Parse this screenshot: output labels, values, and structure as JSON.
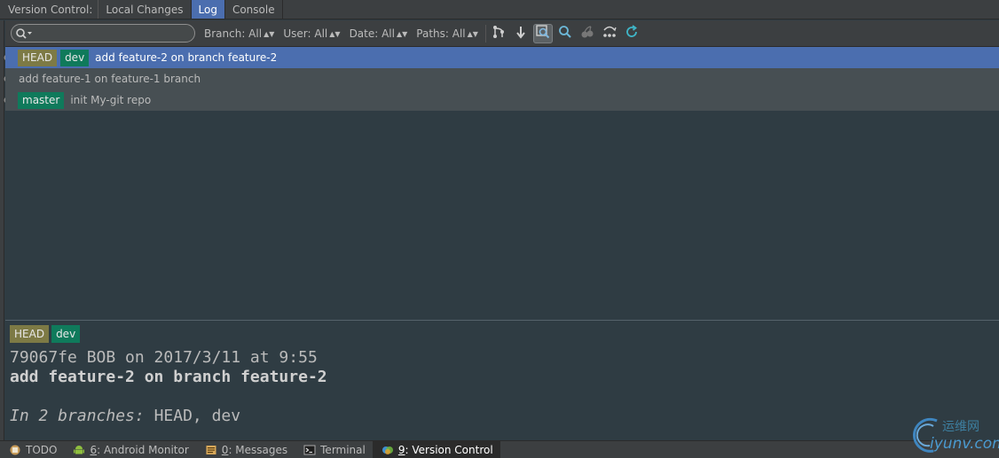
{
  "tabbar": {
    "label": "Version Control:",
    "tabs": [
      {
        "label": "Local Changes",
        "active": false
      },
      {
        "label": "Log",
        "active": true
      },
      {
        "label": "Console",
        "active": false
      }
    ]
  },
  "toolbar": {
    "search_value": "",
    "filters": {
      "branch": "Branch: All",
      "user": "User: All",
      "date": "Date: All",
      "paths": "Paths: All"
    },
    "buttons": [
      "branches-graph-icon",
      "go-to-head-icon",
      "highlight-icon",
      "find-icon",
      "cherry-pick-icon",
      "intellisort-icon",
      "refresh-icon"
    ]
  },
  "log": {
    "rows": [
      {
        "refs": [
          "HEAD",
          "dev"
        ],
        "message": "add feature-2 on branch feature-2",
        "selected": true
      },
      {
        "refs": [],
        "message": "add feature-1 on feature-1 branch",
        "selected": false
      },
      {
        "refs": [
          "master"
        ],
        "message": "init My-git repo",
        "selected": false
      }
    ]
  },
  "details": {
    "refs": [
      "HEAD",
      "dev"
    ],
    "meta": "79067fe BOB on 2017/3/11 at 9:55",
    "subject": "add feature-2 on branch feature-2",
    "branches_label": "In 2 branches:",
    "branches_value": "HEAD, dev"
  },
  "statusbar": {
    "items": [
      {
        "mnemonic": "",
        "label": "TODO",
        "active": false
      },
      {
        "mnemonic": "6",
        "label": ": Android Monitor",
        "active": false
      },
      {
        "mnemonic": "0",
        "label": ": Messages",
        "active": false
      },
      {
        "mnemonic": "",
        "label": "Terminal",
        "active": false
      },
      {
        "mnemonic": "9",
        "label": ": Version Control",
        "active": true
      }
    ]
  },
  "watermark": {
    "cn": "运维网",
    "en": "iyunv.com"
  },
  "colors": {
    "selected_row": "#4b6eaf",
    "head_ref": "#7d7a45",
    "branch_ref": "#0f7a5b",
    "background": "#2f3c43"
  }
}
